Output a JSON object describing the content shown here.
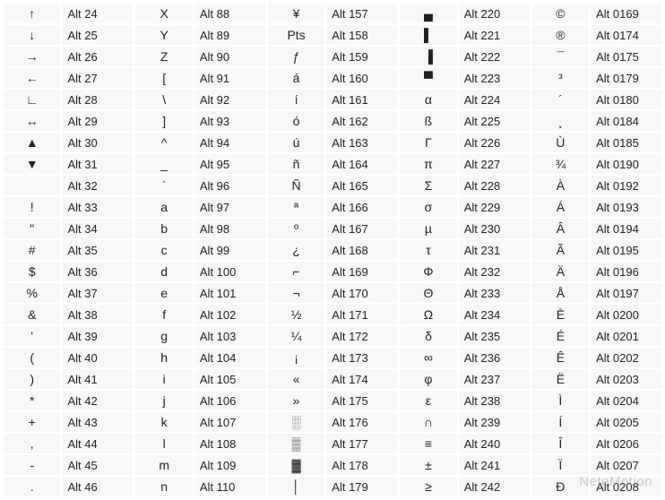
{
  "watermark": "NeteMotion",
  "columns": [
    [
      {
        "symbol": "↑",
        "code": "Alt 24"
      },
      {
        "symbol": "↓",
        "code": "Alt 25"
      },
      {
        "symbol": "→",
        "code": "Alt 26"
      },
      {
        "symbol": "←",
        "code": "Alt 27"
      },
      {
        "symbol": "∟",
        "code": "Alt 28"
      },
      {
        "symbol": "↔",
        "code": "Alt 29"
      },
      {
        "symbol": "▲",
        "code": "Alt 30"
      },
      {
        "symbol": "▼",
        "code": "Alt 31"
      },
      {
        "symbol": "",
        "code": "Alt 32"
      },
      {
        "symbol": "!",
        "code": "Alt 33"
      },
      {
        "symbol": "\"",
        "code": "Alt 34"
      },
      {
        "symbol": "#",
        "code": "Alt 35"
      },
      {
        "symbol": "$",
        "code": "Alt 36"
      },
      {
        "symbol": "%",
        "code": "Alt 37"
      },
      {
        "symbol": "&",
        "code": "Alt 38"
      },
      {
        "symbol": "'",
        "code": "Alt 39"
      },
      {
        "symbol": "(",
        "code": "Alt 40"
      },
      {
        "symbol": ")",
        "code": "Alt 41"
      },
      {
        "symbol": "*",
        "code": "Alt 42"
      },
      {
        "symbol": "+",
        "code": "Alt 43"
      },
      {
        "symbol": ",",
        "code": "Alt 44"
      },
      {
        "symbol": "-",
        "code": "Alt 45"
      },
      {
        "symbol": ".",
        "code": "Alt 46"
      }
    ],
    [
      {
        "symbol": "X",
        "code": "Alt 88"
      },
      {
        "symbol": "Y",
        "code": "Alt 89"
      },
      {
        "symbol": "Z",
        "code": "Alt 90"
      },
      {
        "symbol": "[",
        "code": "Alt 91"
      },
      {
        "symbol": "\\",
        "code": "Alt 92"
      },
      {
        "symbol": "]",
        "code": "Alt 93"
      },
      {
        "symbol": "^",
        "code": "Alt 94"
      },
      {
        "symbol": "_",
        "code": "Alt 95"
      },
      {
        "symbol": "`",
        "code": "Alt 96"
      },
      {
        "symbol": "a",
        "code": "Alt 97"
      },
      {
        "symbol": "b",
        "code": "Alt 98"
      },
      {
        "symbol": "c",
        "code": "Alt 99"
      },
      {
        "symbol": "d",
        "code": "Alt 100"
      },
      {
        "symbol": "e",
        "code": "Alt 101"
      },
      {
        "symbol": "f",
        "code": "Alt 102"
      },
      {
        "symbol": "g",
        "code": "Alt 103"
      },
      {
        "symbol": "h",
        "code": "Alt 104"
      },
      {
        "symbol": "i",
        "code": "Alt 105"
      },
      {
        "symbol": "j",
        "code": "Alt 106"
      },
      {
        "symbol": "k",
        "code": "Alt 107"
      },
      {
        "symbol": "l",
        "code": "Alt 108"
      },
      {
        "symbol": "m",
        "code": "Alt 109"
      },
      {
        "symbol": "n",
        "code": "Alt 110"
      }
    ],
    [
      {
        "symbol": "¥",
        "code": "Alt 157"
      },
      {
        "symbol": "Pts",
        "code": "Alt 158"
      },
      {
        "symbol": "ƒ",
        "code": "Alt 159"
      },
      {
        "symbol": "á",
        "code": "Alt 160"
      },
      {
        "symbol": "í",
        "code": "Alt 161"
      },
      {
        "symbol": "ó",
        "code": "Alt 162"
      },
      {
        "symbol": "ú",
        "code": "Alt 163"
      },
      {
        "symbol": "ñ",
        "code": "Alt 164"
      },
      {
        "symbol": "Ñ",
        "code": "Alt 165"
      },
      {
        "symbol": "ª",
        "code": "Alt 166"
      },
      {
        "symbol": "º",
        "code": "Alt 167"
      },
      {
        "symbol": "¿",
        "code": "Alt 168"
      },
      {
        "symbol": "⌐",
        "code": "Alt 169"
      },
      {
        "symbol": "¬",
        "code": "Alt 170"
      },
      {
        "symbol": "½",
        "code": "Alt 171"
      },
      {
        "symbol": "¼",
        "code": "Alt 172"
      },
      {
        "symbol": "¡",
        "code": "Alt 173"
      },
      {
        "symbol": "«",
        "code": "Alt 174"
      },
      {
        "symbol": "»",
        "code": "Alt 175"
      },
      {
        "symbol": "░",
        "code": "Alt 176"
      },
      {
        "symbol": "▒",
        "code": "Alt 177"
      },
      {
        "symbol": "▓",
        "code": "Alt 178"
      },
      {
        "symbol": "│",
        "code": "Alt 179"
      }
    ],
    [
      {
        "symbol": "▄",
        "code": "Alt 220"
      },
      {
        "symbol": "▌",
        "code": "Alt 221"
      },
      {
        "symbol": "▐",
        "code": "Alt 222"
      },
      {
        "symbol": "▀",
        "code": "Alt 223"
      },
      {
        "symbol": "α",
        "code": "Alt 224"
      },
      {
        "symbol": "ß",
        "code": "Alt 225"
      },
      {
        "symbol": "Γ",
        "code": "Alt 226"
      },
      {
        "symbol": "π",
        "code": "Alt 227"
      },
      {
        "symbol": "Σ",
        "code": "Alt 228"
      },
      {
        "symbol": "σ",
        "code": "Alt 229"
      },
      {
        "symbol": "µ",
        "code": "Alt 230"
      },
      {
        "symbol": "τ",
        "code": "Alt 231"
      },
      {
        "symbol": "Φ",
        "code": "Alt 232"
      },
      {
        "symbol": "Θ",
        "code": "Alt 233"
      },
      {
        "symbol": "Ω",
        "code": "Alt 234"
      },
      {
        "symbol": "δ",
        "code": "Alt 235"
      },
      {
        "symbol": "∞",
        "code": "Alt 236"
      },
      {
        "symbol": "φ",
        "code": "Alt 237"
      },
      {
        "symbol": "ε",
        "code": "Alt 238"
      },
      {
        "symbol": "∩",
        "code": "Alt 239"
      },
      {
        "symbol": "≡",
        "code": "Alt 240"
      },
      {
        "symbol": "±",
        "code": "Alt 241"
      },
      {
        "symbol": "≥",
        "code": "Alt 242"
      }
    ],
    [
      {
        "symbol": "©",
        "code": "Alt 0169"
      },
      {
        "symbol": "®",
        "code": "Alt 0174"
      },
      {
        "symbol": "¯",
        "code": "Alt 0175"
      },
      {
        "symbol": "³",
        "code": "Alt 0179"
      },
      {
        "symbol": "´",
        "code": "Alt 0180"
      },
      {
        "symbol": "¸",
        "code": "Alt 0184"
      },
      {
        "symbol": "Ù",
        "code": "Alt 0185"
      },
      {
        "symbol": "¾",
        "code": "Alt 0190"
      },
      {
        "symbol": "À",
        "code": "Alt 0192"
      },
      {
        "symbol": "Á",
        "code": "Alt 0193"
      },
      {
        "symbol": "Â",
        "code": "Alt 0194"
      },
      {
        "symbol": "Ã",
        "code": "Alt 0195"
      },
      {
        "symbol": "Ä",
        "code": "Alt 0196"
      },
      {
        "symbol": "Å",
        "code": "Alt 0197"
      },
      {
        "symbol": "È",
        "code": "Alt 0200"
      },
      {
        "symbol": "É",
        "code": "Alt 0201"
      },
      {
        "symbol": "Ê",
        "code": "Alt 0202"
      },
      {
        "symbol": "Ë",
        "code": "Alt 0203"
      },
      {
        "symbol": "Ì",
        "code": "Alt 0204"
      },
      {
        "symbol": "Í",
        "code": "Alt 0205"
      },
      {
        "symbol": "Î",
        "code": "Alt 0206"
      },
      {
        "symbol": "Ï",
        "code": "Alt 0207"
      },
      {
        "symbol": "Ð",
        "code": "Alt 0208"
      }
    ]
  ]
}
